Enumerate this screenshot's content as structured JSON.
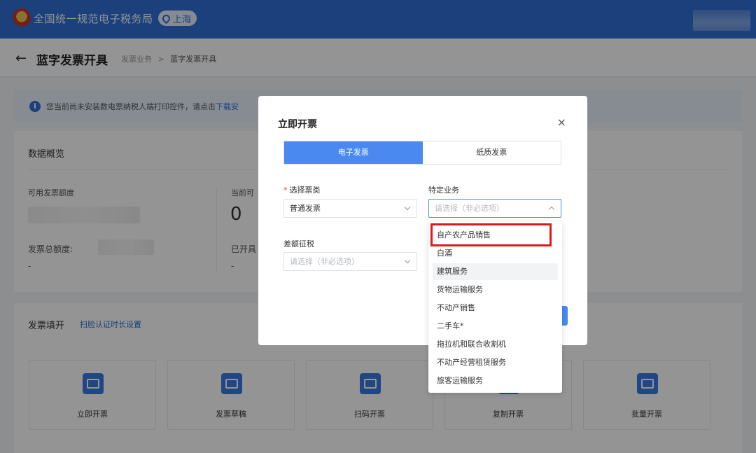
{
  "header": {
    "app_title": "全国统一规范电子税务局",
    "region": "上海",
    "accent": "#2f6fd6"
  },
  "subheader": {
    "back_icon": "arrow-left-icon",
    "page_title": "蓝字发票开具",
    "breadcrumb": {
      "parent": "发票业务",
      "separator": ">",
      "current": "蓝字发票开具"
    }
  },
  "notice": {
    "text": "您当前尚未安装数电票纳税人端打印控件，请点击",
    "link": "下载安"
  },
  "overview": {
    "title": "数据概览",
    "available_label": "可用发票额度",
    "current_label": "当前可",
    "current_value": "0",
    "total_label": "发票总额度:",
    "total_value": "-",
    "issued_label": "已开具",
    "issued_value": "-"
  },
  "fill": {
    "title": "发票填开",
    "link": "扫脸认证时长设置",
    "tiles": [
      {
        "label": "立即开票"
      },
      {
        "label": "发票草稿"
      },
      {
        "label": "扫码开票"
      },
      {
        "label": "复制开票"
      },
      {
        "label": "批量开票"
      }
    ]
  },
  "modal": {
    "title": "立即开票",
    "close": "×",
    "tabs": [
      {
        "label": "电子发票",
        "active": true
      },
      {
        "label": "纸质发票",
        "active": false
      }
    ],
    "invoice_type": {
      "required_mark": "*",
      "label": "选择票类",
      "value": "普通发票"
    },
    "special_business": {
      "label": "特定业务",
      "placeholder": "请选择（非必选项）"
    },
    "diff_tax": {
      "label": "差额征税",
      "placeholder": "请选择（非必选项）"
    }
  },
  "dropdown": {
    "options": [
      "自产农产品销售",
      "白酒",
      "建筑服务",
      "货物运输服务",
      "不动产销售",
      "二手车*",
      "拖拉机和联合收割机",
      "不动产经营租赁服务",
      "旅客运输服务"
    ],
    "hovered_index": 2,
    "highlighted_index": 0,
    "highlight_color": "#e21818"
  }
}
